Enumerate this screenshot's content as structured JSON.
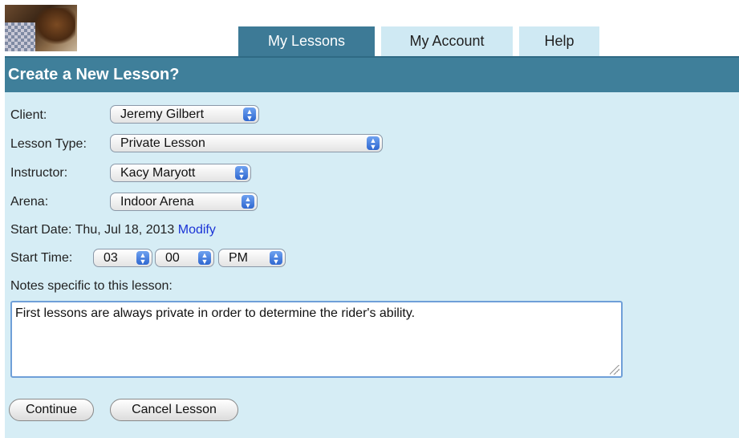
{
  "tabs": {
    "my_lessons": "My Lessons",
    "my_account": "My Account",
    "help": "Help"
  },
  "header": {
    "title": "Create a New Lesson?"
  },
  "form": {
    "client_label": "Client:",
    "client_value": "Jeremy Gilbert",
    "lesson_type_label": "Lesson Type:",
    "lesson_type_value": "Private Lesson",
    "instructor_label": "Instructor:",
    "instructor_value": "Kacy Maryott",
    "arena_label": "Arena:",
    "arena_value": "Indoor Arena",
    "start_date_label": "Start Date:",
    "start_date_value": "Thu, Jul 18, 2013",
    "modify_link": "Modify",
    "start_time_label": "Start Time:",
    "hour_value": "03",
    "minute_value": "00",
    "ampm_value": "PM",
    "notes_label": "Notes specific to this lesson:",
    "notes_value": "First lessons are always private in order to determine the rider's ability."
  },
  "buttons": {
    "continue": "Continue",
    "cancel": "Cancel Lesson"
  },
  "colors": {
    "header_bg": "#3f7f9a",
    "panel_bg": "#d6edf5",
    "active_tab": "#3d7a96",
    "inactive_tab": "#cfe9f3",
    "link": "#1a33d6"
  }
}
